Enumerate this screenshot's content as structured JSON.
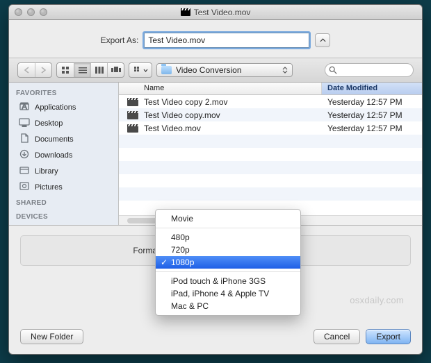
{
  "title": "Test Video.mov",
  "export_as_label": "Export As:",
  "filename": "Test Video.mov",
  "location_name": "Video Conversion",
  "search_placeholder": "",
  "columns": {
    "name": "Name",
    "date": "Date Modified"
  },
  "sidebar": {
    "sections": [
      {
        "header": "FAVORITES",
        "items": [
          {
            "label": "Applications",
            "icon": "applications-icon"
          },
          {
            "label": "Desktop",
            "icon": "desktop-icon"
          },
          {
            "label": "Documents",
            "icon": "documents-icon"
          },
          {
            "label": "Downloads",
            "icon": "downloads-icon"
          },
          {
            "label": "Library",
            "icon": "library-icon"
          },
          {
            "label": "Pictures",
            "icon": "pictures-icon"
          }
        ]
      },
      {
        "header": "SHARED",
        "items": []
      },
      {
        "header": "DEVICES",
        "items": []
      }
    ]
  },
  "files": [
    {
      "name": "Test Video copy 2.mov",
      "date": "Yesterday 12:57 PM"
    },
    {
      "name": "Test Video copy.mov",
      "date": "Yesterday 12:57 PM"
    },
    {
      "name": "Test Video.mov",
      "date": "Yesterday 12:57 PM"
    }
  ],
  "format_label": "Format:",
  "format_menu": {
    "groups": [
      [
        "Movie"
      ],
      [
        "480p",
        "720p",
        "1080p"
      ],
      [
        "iPod touch & iPhone 3GS",
        "iPad, iPhone 4 & Apple TV",
        "Mac & PC"
      ]
    ],
    "selected": "1080p"
  },
  "buttons": {
    "new_folder": "New Folder",
    "cancel": "Cancel",
    "export": "Export"
  },
  "watermark": "osxdaily.com"
}
